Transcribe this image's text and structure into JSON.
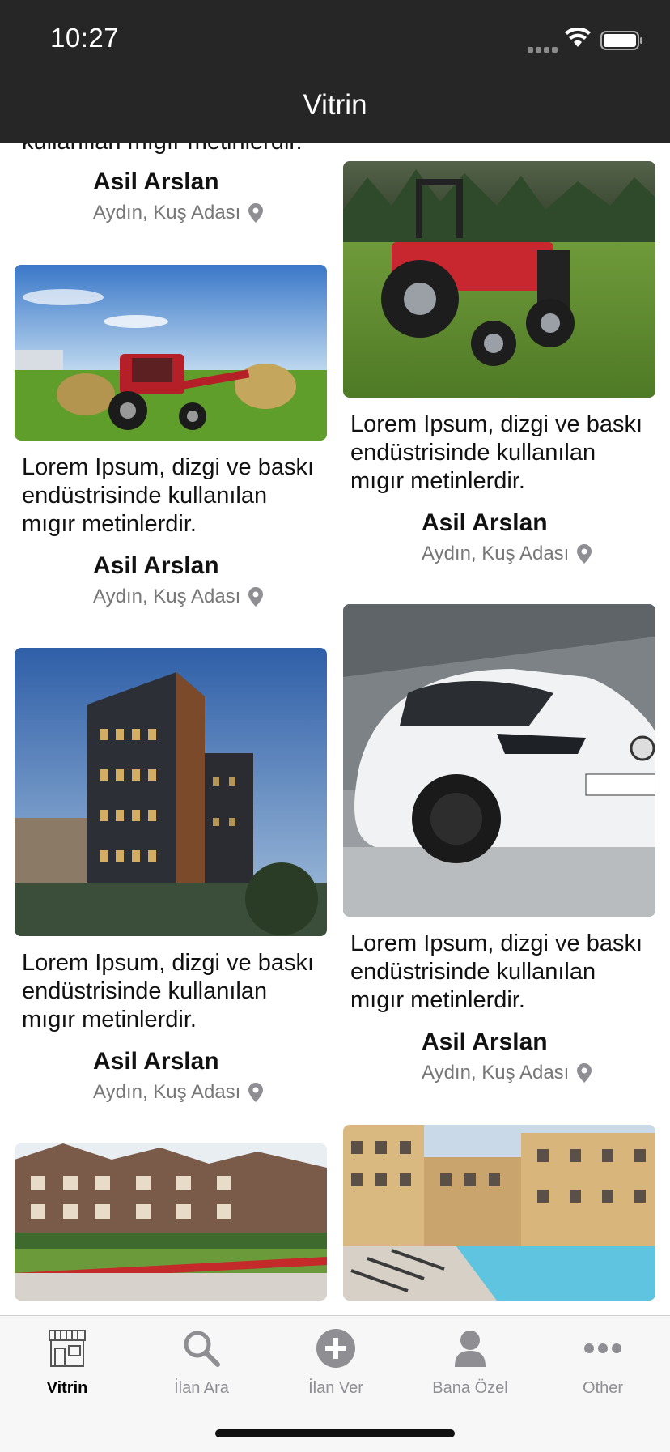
{
  "status": {
    "time": "10:27"
  },
  "nav": {
    "title": "Vitrin"
  },
  "listings": [
    {
      "description": "Lorem Ipsum, dizgi ve baskı endüstrisinde kullanılan mıgır metinlerdir.",
      "partial_top_text": "kullanılan mıgır metinlerdir.",
      "seller": "Asil Arslan",
      "location": "Aydın, Kuş Adası"
    },
    {
      "description": "Lorem Ipsum, dizgi ve baskı endüstrisinde kullanılan mıgır metinlerdir.",
      "seller": "Asil Arslan",
      "location": "Aydın, Kuş Adası",
      "image": "red tractor on grass"
    },
    {
      "description": "Lorem Ipsum, dizgi ve baskı endüstrisinde kullanılan mıgır metinlerdir.",
      "seller": "Asil Arslan",
      "location": "Aydın, Kuş Adası",
      "image": "tractor with hay bales"
    },
    {
      "description": "Lorem Ipsum, dizgi ve baskı endüstrisinde kullanılan mıgır metinlerdir.",
      "seller": "Asil Arslan",
      "location": "Aydın, Kuş Adası",
      "image": "white car in garage"
    },
    {
      "description": "Lorem Ipsum, dizgi ve baskı endüstrisinde kullanılan mıgır metinlerdir.",
      "seller": "Asil Arslan",
      "location": "Aydın, Kuş Adası",
      "image": "modern apartment tower"
    },
    {
      "image": "townhouse complex"
    },
    {
      "image": "apartments with pool"
    }
  ],
  "tabs": [
    {
      "label": "Vitrin",
      "icon": "storefront-icon",
      "active": true
    },
    {
      "label": "İlan Ara",
      "icon": "search-icon",
      "active": false
    },
    {
      "label": "İlan Ver",
      "icon": "plus-circle-icon",
      "active": false
    },
    {
      "label": "Bana Özel",
      "icon": "person-icon",
      "active": false
    },
    {
      "label": "Other",
      "icon": "more-icon",
      "active": false
    }
  ],
  "colors": {
    "bar": "#262626",
    "accent": "#000000",
    "inactive_tab": "#8e8e93"
  }
}
